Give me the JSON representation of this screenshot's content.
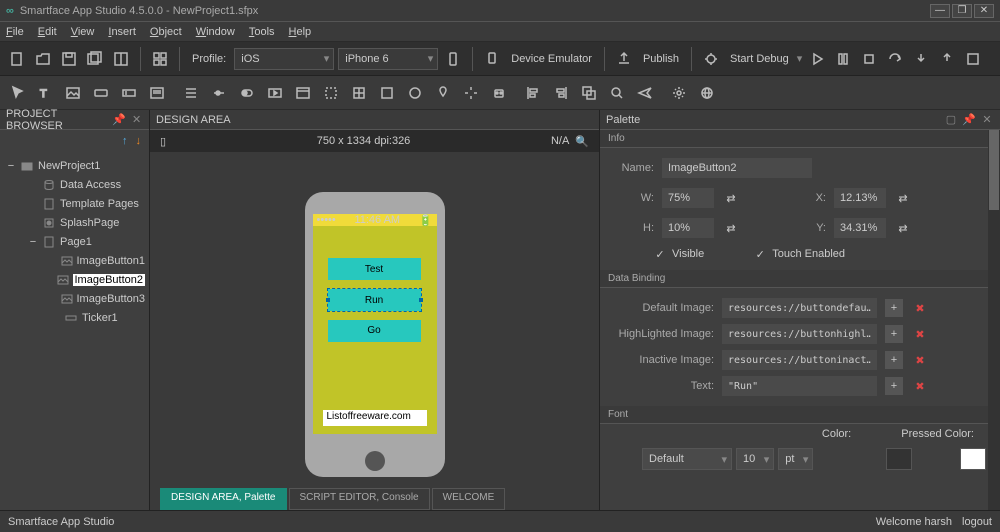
{
  "window": {
    "title": "Smartface App Studio 4.5.0.0 - NewProject1.sfpx",
    "app_name": "Smartface App Studio"
  },
  "menu": [
    "File",
    "Edit",
    "View",
    "Insert",
    "Object",
    "Window",
    "Tools",
    "Help"
  ],
  "toolbar": {
    "profile_label": "Profile:",
    "profile_value": "iOS",
    "device_value": "iPhone 6",
    "emulator": "Device Emulator",
    "publish": "Publish",
    "debug": "Start Debug"
  },
  "project_browser": {
    "title": "PROJECT BROWSER",
    "items": [
      {
        "level": 1,
        "exp": "−",
        "name": "NewProject1",
        "icon": "folder"
      },
      {
        "level": 2,
        "exp": "",
        "name": "Data Access",
        "icon": "db"
      },
      {
        "level": 2,
        "exp": "",
        "name": "Template Pages",
        "icon": "page"
      },
      {
        "level": 2,
        "exp": "",
        "name": "SplashPage",
        "icon": "splash"
      },
      {
        "level": 2,
        "exp": "−",
        "name": "Page1",
        "icon": "page"
      },
      {
        "level": 3,
        "exp": "",
        "name": "ImageButton1",
        "icon": "img"
      },
      {
        "level": 3,
        "exp": "",
        "name": "ImageButton2",
        "icon": "img",
        "selected": true
      },
      {
        "level": 3,
        "exp": "",
        "name": "ImageButton3",
        "icon": "img"
      },
      {
        "level": 3,
        "exp": "",
        "name": "Ticker1",
        "icon": "ticker"
      }
    ]
  },
  "design": {
    "title": "DESIGN AREA",
    "dims": "750 x 1334 dpi:326",
    "na": "N/A",
    "status_time": "11:46 AM",
    "btn1": "Test",
    "btn2": "Run",
    "btn3": "Go",
    "ticker": "Listoffreeware.com"
  },
  "palette": {
    "title": "Palette",
    "info": "Info",
    "name_label": "Name:",
    "name_value": "ImageButton2",
    "w_label": "W:",
    "w_value": "75%",
    "h_label": "H:",
    "h_value": "10%",
    "x_label": "X:",
    "x_value": "12.13%",
    "y_label": "Y:",
    "y_value": "34.31%",
    "visible": "Visible",
    "touch": "Touch Enabled",
    "databinding": "Data Binding",
    "def_img": "Default Image:",
    "def_val": "resources://buttondefau…",
    "hi_img": "HighLighted Image:",
    "hi_val": "resources://buttonhighl…",
    "in_img": "Inactive Image:",
    "in_val": "resources://buttoninact…",
    "text_label": "Text:",
    "text_val": "\"Run\"",
    "font": "Font",
    "font_family": "Default",
    "font_size": "10",
    "font_unit": "pt",
    "color": "Color:",
    "pressed": "Pressed Color:"
  },
  "tabs": {
    "t1": "DESIGN AREA, Palette",
    "t2": "SCRIPT EDITOR, Console",
    "t3": "WELCOME"
  },
  "status": {
    "user": "Welcome harsh",
    "logout": "logout"
  }
}
